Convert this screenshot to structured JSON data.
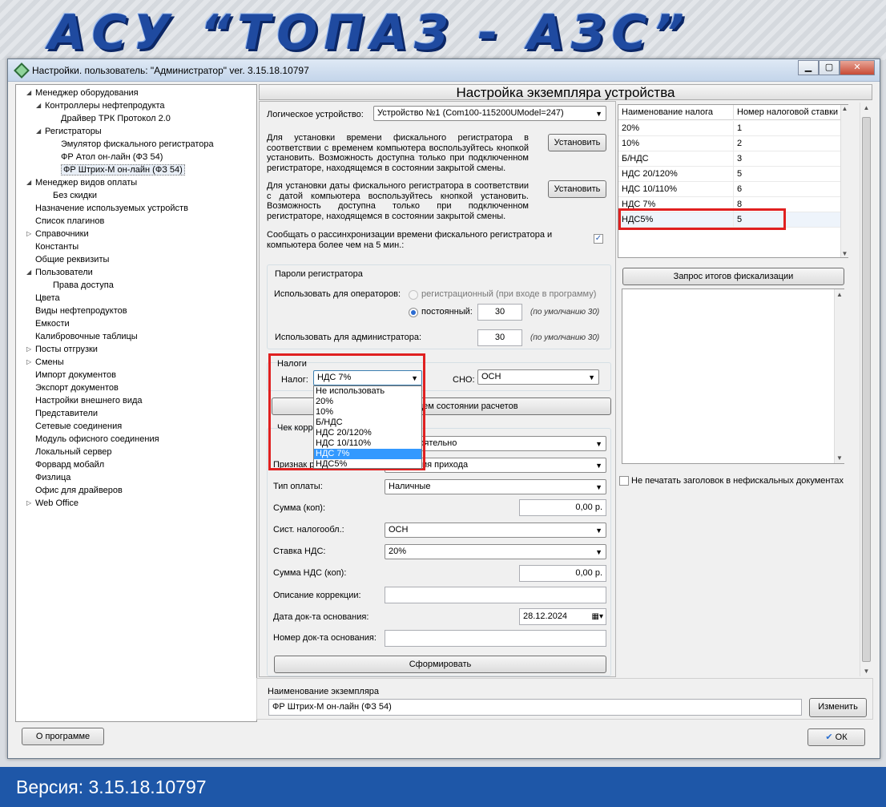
{
  "banner": {
    "title": "АСУ “ТОПАЗ - АЗС”"
  },
  "footer": {
    "version": "Версия: 3.15.18.10797"
  },
  "window": {
    "title": "Настройки. пользователь: \"Администратор\" ver. 3.15.18.10797",
    "buttons": {
      "minimize": "▁",
      "maximize": "▢",
      "close": "✕"
    }
  },
  "tree": {
    "items": [
      {
        "label": "Менеджер оборудования",
        "exp": "◢"
      },
      {
        "label": "Контроллеры нефтепродукта",
        "exp": "◢"
      },
      {
        "label": "Драйвер ТРК Протокол 2.0",
        "exp": ""
      },
      {
        "label": "Регистраторы",
        "exp": "◢"
      },
      {
        "label": "Эмулятор фискального регистратора",
        "exp": ""
      },
      {
        "label": "ФР Атол он-лайн (ФЗ 54)",
        "exp": ""
      },
      {
        "label": "ФР Штрих-М он-лайн (ФЗ 54)",
        "exp": ""
      },
      {
        "label": "Менеджер видов оплаты",
        "exp": "◢"
      },
      {
        "label": "Без скидки",
        "exp": ""
      },
      {
        "label": "Назначение используемых устройств",
        "exp": ""
      },
      {
        "label": "Список плагинов",
        "exp": ""
      },
      {
        "label": "Справочники",
        "exp": "▷"
      },
      {
        "label": "Константы",
        "exp": ""
      },
      {
        "label": "Общие реквизиты",
        "exp": ""
      },
      {
        "label": "Пользователи",
        "exp": "◢"
      },
      {
        "label": "Права доступа",
        "exp": ""
      },
      {
        "label": "Цвета",
        "exp": ""
      },
      {
        "label": "Виды нефтепродуктов",
        "exp": ""
      },
      {
        "label": "Емкости",
        "exp": ""
      },
      {
        "label": "Калибровочные таблицы",
        "exp": ""
      },
      {
        "label": "Посты отгрузки",
        "exp": "▷"
      },
      {
        "label": "Смены",
        "exp": "▷"
      },
      {
        "label": "Импорт документов",
        "exp": ""
      },
      {
        "label": "Экспорт документов",
        "exp": ""
      },
      {
        "label": "Настройки внешнего вида",
        "exp": ""
      },
      {
        "label": "Представители",
        "exp": ""
      },
      {
        "label": "Сетевые соединения",
        "exp": ""
      },
      {
        "label": "Модуль офисного соединения",
        "exp": ""
      },
      {
        "label": "Локальный сервер",
        "exp": ""
      },
      {
        "label": "Форвард мобайл",
        "exp": ""
      },
      {
        "label": "Физлица",
        "exp": ""
      },
      {
        "label": "Офис для драйверов",
        "exp": ""
      },
      {
        "label": "Web Office",
        "exp": "▷"
      }
    ]
  },
  "panel": {
    "header": "Настройка экземпляра устройства",
    "logical_device_label": "Логическое устройство:",
    "logical_device_value": "Устройство №1 (Com100-115200UModel=247)",
    "time_text": "Для установки времени фискального регистратора в соответствии с временем компьютера воспользуйтесь кнопкой установить. Возможность доступна только при подключенном регистраторе, находящемся в состоянии закрытой смены.",
    "date_text": "Для установки даты фискального регистратора в соответствии с датой компьютера воспользуйтесь кнопкой установить. Возможность доступна только при подключенном регистраторе, находящемся в состоянии закрытой смены.",
    "set_button": "Установить",
    "desync_text": "Сообщать о рассинхронизации времени фискального регистратора и компьютера более чем на 5 мин.:",
    "passwords_title": "Пароли регистратора",
    "operators_label": "Использовать для операторов:",
    "radio_reg": "регистрационный (при входе в программу)",
    "radio_const": "постоянный:",
    "operator_pwd": "30",
    "default_hint": "(по умолчанию 30)",
    "admin_label": "Использовать для администратора:",
    "admin_pwd": "30",
    "taxes_title": "Налоги",
    "tax_label": "Налог:",
    "tax_value": "НДС 7%",
    "sno_label": "СНО:",
    "sno_value": "ОСН",
    "report_button": "Отчет о текущем состоянии расчетов",
    "correction_title": "Чек коррекции",
    "corr_type_value": "Самостоятельно",
    "sign_label": "Признак расчета:",
    "sign_value": "Коррекция прихода",
    "payment_label": "Тип оплаты:",
    "payment_value": "Наличные",
    "sum_label": "Сумма (коп):",
    "sum_value": "0,00 р.",
    "sno2_label": "Сист. налогообл.:",
    "sno2_value": "ОСН",
    "vat_rate_label": "Ставка НДС:",
    "vat_rate_value": "20%",
    "vat_sum_label": "Сумма НДС (коп):",
    "vat_sum_value": "0,00 р.",
    "corr_desc_label": "Описание коррекции:",
    "corr_desc_value": "",
    "doc_date_label": "Дата док-та основания:",
    "doc_date_value": "28.12.2024",
    "doc_num_label": "Номер док-та основания:",
    "doc_num_value": "",
    "form_button": "Сформировать"
  },
  "tax_dropdown": {
    "options": [
      "Не использовать",
      "20%",
      "10%",
      "Б/НДС",
      "НДС 20/120%",
      "НДС 10/110%",
      "НДС 7%",
      "НДС5%"
    ],
    "highlighted": "НДС 7%"
  },
  "tax_table": {
    "headers": [
      "Наименование налога",
      "Номер налоговой ставки"
    ],
    "rows": [
      [
        "20%",
        "1"
      ],
      [
        "10%",
        "2"
      ],
      [
        "Б/НДС",
        "3"
      ],
      [
        "НДС 20/120%",
        "5"
      ],
      [
        "НДС 10/110%",
        "6"
      ],
      [
        "НДС 7%",
        "8"
      ],
      [
        "НДС5%",
        "5"
      ]
    ]
  },
  "fiscal": {
    "request_button": "Запрос итогов фискализации",
    "no_header_label": "Не печатать заголовок в нефискальных документах"
  },
  "instance": {
    "label": "Наименование экземпляра",
    "value": "ФР Штрих-М он-лайн (ФЗ 54)",
    "change_button": "Изменить"
  },
  "bottom": {
    "about_button": "О программе",
    "ok_button": "ОК"
  },
  "colors": {
    "accent_red": "#e02020",
    "footer_blue": "#1e57a8",
    "title_blue": "#1f4aa0"
  }
}
